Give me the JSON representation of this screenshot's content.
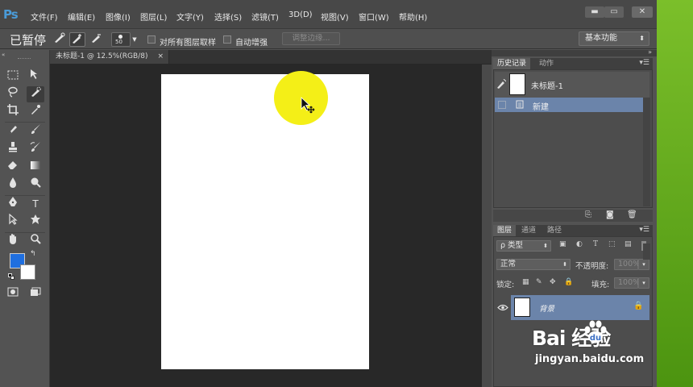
{
  "app": {
    "logo": "Ps"
  },
  "menubar": {
    "items": [
      "文件(F)",
      "编辑(E)",
      "图像(I)",
      "图层(L)",
      "文字(Y)",
      "选择(S)",
      "滤镜(T)",
      "3D(D)",
      "视图(V)",
      "窗口(W)",
      "帮助(H)"
    ],
    "minimize": "▬",
    "restore": "▭",
    "close": "✕"
  },
  "options": {
    "paused_label": "已暂停",
    "brush_size": "50",
    "sample_all_layers_label": "对所有图层取样",
    "auto_enhance_label": "自动增强",
    "refine_edge_label": "调整边缘...",
    "workspace_value": "基本功能"
  },
  "document": {
    "tab_title": "未标题-1 @ 12.5%(RGB/8)",
    "tab_close": "×"
  },
  "history_panel": {
    "tabs": [
      "历史记录",
      "动作"
    ],
    "snapshot_label": "未标题-1",
    "states": [
      "新建"
    ]
  },
  "layers_panel": {
    "tabs": [
      "图层",
      "通道",
      "路径"
    ],
    "filter_kind": "ρ 类型",
    "blend_mode": "正常",
    "opacity_label": "不透明度:",
    "opacity_value": "100%",
    "lock_label": "锁定:",
    "fill_label": "填充:",
    "fill_value": "100%",
    "layer_name": "背景"
  },
  "watermark": {
    "brand": "Bai 经验",
    "url": "jingyan.baidu.com"
  },
  "colors": {
    "foreground": "#1f6fe0",
    "background": "#ffffff",
    "selection": "#6b84aa",
    "cursor_highlight": "#f4ef17"
  }
}
